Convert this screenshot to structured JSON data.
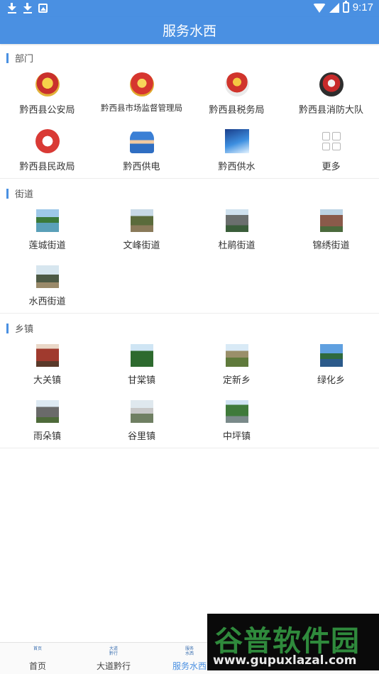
{
  "status_bar": {
    "time": "9:17"
  },
  "header": {
    "title": "服务水西"
  },
  "sections": {
    "departments": {
      "title": "部门",
      "items": [
        {
          "label": "黔西县公安局",
          "icon": "police-emblem-icon"
        },
        {
          "label": "黔西县市场监督管理局",
          "icon": "market-regulation-emblem-icon"
        },
        {
          "label": "黔西县税务局",
          "icon": "tax-emblem-icon"
        },
        {
          "label": "黔西县消防大队",
          "icon": "fire-brigade-emblem-icon"
        },
        {
          "label": "黔西县民政局",
          "icon": "civil-affairs-emblem-icon"
        },
        {
          "label": "黔西供电",
          "icon": "power-supply-icon"
        },
        {
          "label": "黔西供水",
          "icon": "water-supply-icon"
        },
        {
          "label": "更多",
          "icon": "more-grid-icon"
        }
      ]
    },
    "streets": {
      "title": "街道",
      "items": [
        {
          "label": "莲城街道"
        },
        {
          "label": "文峰街道"
        },
        {
          "label": "杜鹃街道"
        },
        {
          "label": "锦绣街道"
        },
        {
          "label": "水西街道"
        }
      ]
    },
    "towns": {
      "title": "乡镇",
      "items": [
        {
          "label": "大关镇"
        },
        {
          "label": "甘棠镇"
        },
        {
          "label": "定新乡"
        },
        {
          "label": "绿化乡"
        },
        {
          "label": "雨朵镇"
        },
        {
          "label": "谷里镇"
        },
        {
          "label": "中坪镇"
        }
      ]
    }
  },
  "bottom_nav": {
    "items": [
      {
        "label": "首页",
        "icon_text": "首页"
      },
      {
        "label": "大道黔行",
        "icon_text": "大道黔行"
      },
      {
        "label": "服务水西",
        "icon_text": "服务水西"
      }
    ],
    "active_index": 2
  },
  "watermark": {
    "title": "谷普软件园",
    "url": "www.gupuxlazal.com"
  },
  "colors": {
    "primary": "#4a90e2",
    "text": "#333333",
    "section_title": "#555555"
  }
}
